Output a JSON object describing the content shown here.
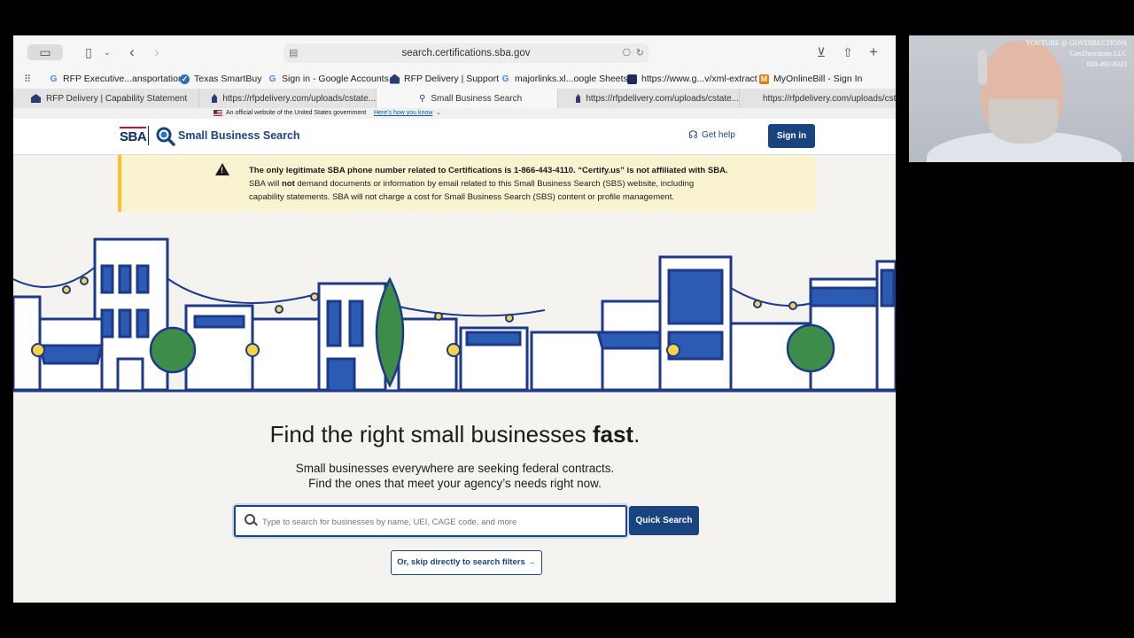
{
  "browser": {
    "url": "search.certifications.sba.gov",
    "favorites": [
      {
        "label": "RFP Executive...ansportation",
        "icon": "google-icon",
        "color": "#4285f4"
      },
      {
        "label": "Texas SmartBuy",
        "icon": "texas-smartbuy-icon",
        "color": "#2a6ebb"
      },
      {
        "label": "Sign in - Google Accounts",
        "icon": "google-icon",
        "color": "#4285f4"
      },
      {
        "label": "RFP Delivery | Support",
        "icon": "rfp-delivery-icon",
        "color": "#2b3a78"
      },
      {
        "label": "majorlinks.xl...oogle Sheets",
        "icon": "google-icon",
        "color": "#4285f4"
      },
      {
        "label": "https://www.g...v/xml-extract",
        "icon": "dark-square-icon",
        "color": "#1d2c5a"
      },
      {
        "label": "MyOnlineBill - Sign In",
        "icon": "myonlinebill-icon",
        "color": "#e07b14"
      }
    ],
    "tabs": [
      {
        "label": "RFP Delivery | Capability Statement",
        "active": false
      },
      {
        "label": "https://rfpdelivery.com/uploads/cstate...",
        "active": false
      },
      {
        "label": "Small Business Search",
        "active": true
      },
      {
        "label": "https://rfpdelivery.com/uploads/cstate...",
        "active": false
      },
      {
        "label": "https://rfpdelivery.com/uploads/cst",
        "active": false
      }
    ]
  },
  "gov_banner": {
    "text": "An official website of the United States government",
    "link": "Here's how you know"
  },
  "header": {
    "logo": "SBA",
    "title": "Small Business Search",
    "get_help": "Get help",
    "sign_in": "Sign in"
  },
  "alert": {
    "line1": "The only legitimate SBA phone number related to Certifications is 1-866-443-4110. “Certify.us” is not affiliated with SBA.",
    "line2_a": "SBA will",
    "line2_b": "not",
    "line2_c": "demand documents or information by email related to this Small Business Search (SBS) website, including",
    "line3": "capability statements. SBA will not charge a cost for Small Business Search (SBS) content or profile management."
  },
  "hero": {
    "title_a": "Find the right small businesses",
    "title_b": "fast",
    "title_c": ".",
    "sub1": "Small businesses everywhere are seeking federal contracts.",
    "sub2": "Find the ones that meet your agency’s needs right now."
  },
  "search": {
    "placeholder": "Type to search for businesses by name, UEI, CAGE code, and more",
    "button": "Quick Search",
    "skip": "Or, skip directly to search filters →"
  },
  "webcam": {
    "channel": "YOUTUBE @ GOVDIRECTIONS",
    "company": "GovDirections LLC",
    "phone": "800-492-8323"
  },
  "colors": {
    "primary": "#1a4480",
    "alert_bg": "#faf3d1",
    "alert_border": "#ffbe2e",
    "illustration_navy": "#1d3a8a",
    "illustration_green": "#3d8c4a",
    "illustration_yellow": "#f5d547"
  }
}
